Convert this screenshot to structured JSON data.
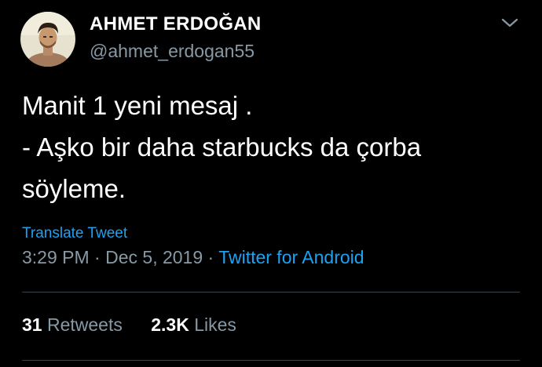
{
  "author": {
    "display_name": "AHMET ERDOĞAN",
    "handle": "@ahmet_erdogan55"
  },
  "tweet": {
    "lines": [
      "Manit 1 yeni mesaj .",
      "- Aşko bir daha starbucks da çorba",
      "söyleme."
    ]
  },
  "translate_label": "Translate Tweet",
  "meta": {
    "time": "3:29 PM",
    "separator": "·",
    "date": "Dec 5, 2019",
    "source": "Twitter for Android"
  },
  "stats": {
    "retweets_count": "31",
    "retweets_label": "Retweets",
    "likes_count": "2.3K",
    "likes_label": "Likes"
  },
  "icons": {
    "menu": "chevron-down-icon"
  },
  "colors": {
    "background": "#000000",
    "text": "#ffffff",
    "secondary": "#8899a6",
    "link": "#1da1f2",
    "divider": "#38444d"
  }
}
